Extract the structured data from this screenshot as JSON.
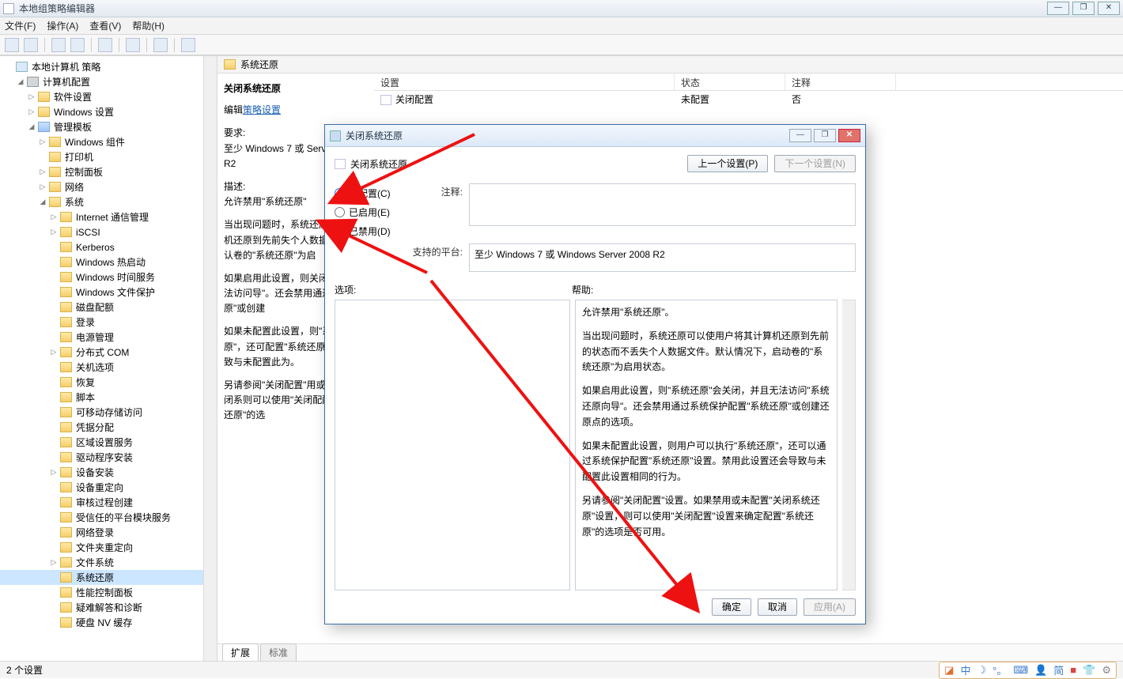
{
  "window": {
    "title": "本地组策略编辑器"
  },
  "menu": {
    "file": "文件(F)",
    "action": "操作(A)",
    "view": "查看(V)",
    "help": "帮助(H)"
  },
  "tree": {
    "root": "本地计算机 策略",
    "computer": "计算机配置",
    "soft": "软件设置",
    "windows": "Windows 设置",
    "admin": "管理模板",
    "wincomp": "Windows 组件",
    "printers": "打印机",
    "ctrlpanel": "控制面板",
    "network": "网络",
    "system": "系统",
    "items": [
      "Internet 通信管理",
      "iSCSI",
      "Kerberos",
      "Windows 热启动",
      "Windows 时间服务",
      "Windows 文件保护",
      "磁盘配额",
      "登录",
      "电源管理",
      "分布式 COM",
      "关机选项",
      "恢复",
      "脚本",
      "可移动存储访问",
      "凭据分配",
      "区域设置服务",
      "驱动程序安装",
      "设备安装",
      "设备重定向",
      "审核过程创建",
      "受信任的平台模块服务",
      "网络登录",
      "文件夹重定向",
      "文件系统",
      "系统还原",
      "性能控制面板",
      "疑难解答和诊断",
      "硬盘 NV 缓存"
    ]
  },
  "content": {
    "header": "系统还原",
    "desc_title": "关闭系统还原",
    "edit": "编辑",
    "policy_link": "策略设置",
    "req_label": "要求:",
    "req_text": "至少 Windows 7 或 Server 2008 R2",
    "desc_label": "描述:",
    "desc_p1": "允许禁用\"系统还原\"",
    "desc_p2": "当出现问题时，系统还原将其计算机还原到先前失个人数据文件。默认卷的\"系统还原\"为启",
    "desc_p3": "如果启用此设置，则关闭，并且无法访问导\"。还会禁用通过\"系统还原\"或创建",
    "desc_p4": "如果未配置此设置，则\"系统还原\"，还可配置\"系统还原\"设还会导致与未配置此为。",
    "desc_p5": "另请参阅\"关闭配置\"用或未配置\"关闭系则可以使用\"关闭配配置\"系统还原\"的选",
    "cols": {
      "a": "设置",
      "b": "状态",
      "c": "注释"
    },
    "row": {
      "name": "关闭配置",
      "state": "未配置",
      "note": "否"
    },
    "tabs": {
      "ext": "扩展",
      "std": "标准"
    }
  },
  "dialog": {
    "title": "关闭系统还原",
    "heading": "关闭系统还原",
    "prev": "上一个设置(P)",
    "next": "下一个设置(N)",
    "r_notconf": "未配置(C)",
    "r_enabled": "已启用(E)",
    "r_disabled": "已禁用(D)",
    "comment": "注释:",
    "platforms": "支持的平台:",
    "plat_text": "至少 Windows 7 或 Windows Server 2008 R2",
    "options": "选项:",
    "help": "帮助:",
    "help_paras": [
      "允许禁用\"系统还原\"。",
      "当出现问题时，系统还原可以使用户将其计算机还原到先前的状态而不丢失个人数据文件。默认情况下，启动卷的\"系统还原\"为启用状态。",
      "如果启用此设置，则\"系统还原\"会关闭，并且无法访问\"系统还原向导\"。还会禁用通过系统保护配置\"系统还原\"或创建还原点的选项。",
      "如果未配置此设置，则用户可以执行\"系统还原\"，还可以通过系统保护配置\"系统还原\"设置。禁用此设置还会导致与未配置此设置相同的行为。",
      "另请参阅\"关闭配置\"设置。如果禁用或未配置\"关闭系统还原\"设置，则可以使用\"关闭配置\"设置来确定配置\"系统还原\"的选项是否可用。"
    ],
    "ok": "确定",
    "cancel": "取消",
    "apply": "应用(A)"
  },
  "status": {
    "text": "2 个设置"
  },
  "tray": {
    "a": "中",
    "b": "简"
  }
}
